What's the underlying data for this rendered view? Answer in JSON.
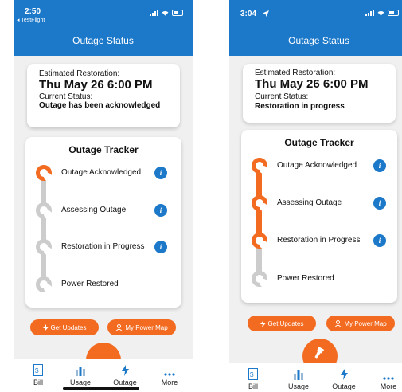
{
  "colors": {
    "primary_blue": "#1c78c8",
    "accent_orange": "#f26b21",
    "inactive_gray": "#cccccc"
  },
  "left": {
    "status_time": "2:50",
    "status_back_label": "◂ TestFlight",
    "nav_title": "Outage Status",
    "restoration_label": "Estimated Restoration:",
    "restoration_datetime": "Thu May 26  6:00 PM",
    "current_status_label": "Current Status:",
    "current_status_value": "Outage has been acknowledged",
    "tracker_title": "Outage Tracker",
    "steps": [
      {
        "label": "Outage Acknowledged",
        "state": "active",
        "info_icon": "i"
      },
      {
        "label": "Assessing Outage",
        "state": "inactive",
        "info_icon": "i"
      },
      {
        "label": "Restoration in Progress",
        "state": "inactive",
        "info_icon": "i"
      },
      {
        "label": "Power Restored",
        "state": "inactive"
      }
    ],
    "get_updates_label": "Get Updates",
    "power_map_label": "My Power Map",
    "tabs": [
      {
        "label": "Bill",
        "icon": "bill-icon"
      },
      {
        "label": "Usage",
        "icon": "usage-icon"
      },
      {
        "label": "Outage",
        "icon": "outage-icon"
      },
      {
        "label": "More",
        "icon": "more-icon"
      }
    ]
  },
  "right": {
    "status_time": "3:04",
    "nav_title": "Outage Status",
    "restoration_label": "Estimated Restoration:",
    "restoration_datetime": "Thu May 26  6:00 PM",
    "current_status_label": "Current Status:",
    "current_status_value": "Restoration in progress",
    "tracker_title": "Outage Tracker",
    "steps": [
      {
        "label": "Outage Acknowledged",
        "state": "done",
        "info_icon": "i"
      },
      {
        "label": "Assessing Outage",
        "state": "done",
        "info_icon": "i"
      },
      {
        "label": "Restoration in Progress",
        "state": "done",
        "info_icon": "i"
      },
      {
        "label": "Power Restored",
        "state": "inactive"
      }
    ],
    "get_updates_label": "Get Updates",
    "power_map_label": "My Power Map",
    "tabs": [
      {
        "label": "Bill",
        "icon": "bill-icon"
      },
      {
        "label": "Usage",
        "icon": "usage-icon"
      },
      {
        "label": "Outage",
        "icon": "outage-icon"
      },
      {
        "label": "More",
        "icon": "more-icon"
      }
    ]
  }
}
